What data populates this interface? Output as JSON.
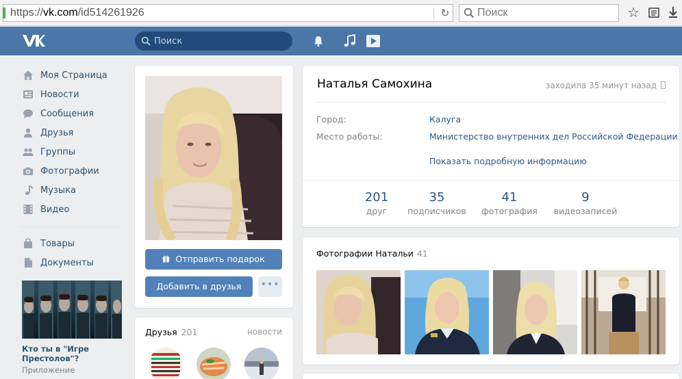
{
  "browser": {
    "url_prefix": "https://",
    "url_host": "vk.com",
    "url_path": "/id514261926",
    "search_placeholder": "Поиск"
  },
  "header": {
    "search_placeholder": "Поиск"
  },
  "nav": {
    "items": [
      {
        "label": "Моя Страница",
        "icon": "home-icon"
      },
      {
        "label": "Новости",
        "icon": "news-icon"
      },
      {
        "label": "Сообщения",
        "icon": "messages-icon"
      },
      {
        "label": "Друзья",
        "icon": "friends-icon"
      },
      {
        "label": "Группы",
        "icon": "groups-icon"
      },
      {
        "label": "Фотографии",
        "icon": "camera-icon"
      },
      {
        "label": "Музыка",
        "icon": "music-note-icon"
      },
      {
        "label": "Видео",
        "icon": "film-icon"
      }
    ],
    "items2": [
      {
        "label": "Товары",
        "icon": "bag-icon"
      },
      {
        "label": "Документы",
        "icon": "document-icon"
      }
    ]
  },
  "ad": {
    "title": "Кто ты в \"Игре Престолов\"?",
    "subtitle": "Приложение"
  },
  "profile": {
    "name": "Наталья Самохина",
    "last_seen": "заходила 35 минут назад",
    "city_label": "Город:",
    "city_value": "Калуга",
    "work_label": "Место работы:",
    "work_value": "Министерство внутренних дел Российской Федерации",
    "more_info": "Показать подробную информацию",
    "gift_button": "Отправить подарок",
    "add_friend_button": "Добавить в друзья",
    "more_button": "•••"
  },
  "stats": [
    {
      "num": "201",
      "label": "друг"
    },
    {
      "num": "35",
      "label": "подписчиков"
    },
    {
      "num": "41",
      "label": "фотография"
    },
    {
      "num": "9",
      "label": "видеозаписей"
    }
  ],
  "friends": {
    "title": "Друзья",
    "count": "201",
    "news_link": "новости"
  },
  "photos": {
    "title": "Фотографии Натальи",
    "count": "41"
  },
  "colors": {
    "vk_blue": "#4a76a8",
    "button_blue": "#5181b8",
    "link": "#2a5885"
  }
}
